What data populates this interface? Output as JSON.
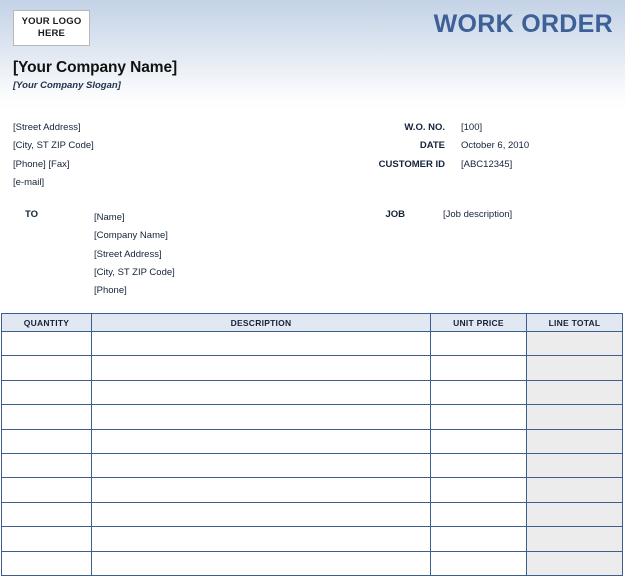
{
  "header": {
    "logo_placeholder_line1": "YOUR LOGO",
    "logo_placeholder_line2": "HERE",
    "document_title": "WORK ORDER",
    "title_color": "#3c6097",
    "company_name": "[Your Company Name]",
    "company_slogan": "[Your Company Slogan]"
  },
  "sender_address": {
    "lines": [
      "[Street Address]",
      "[City, ST  ZIP Code]",
      "[Phone] [Fax]",
      "[e-mail]"
    ]
  },
  "meta": {
    "rows": [
      {
        "label": "W.O. NO.",
        "value": "[100]"
      },
      {
        "label": "DATE",
        "value": "October 6, 2010"
      },
      {
        "label": "CUSTOMER ID",
        "value": "[ABC12345]"
      }
    ]
  },
  "recipient": {
    "label": "TO",
    "lines": [
      "[Name]",
      "[Company Name]",
      "[Street Address]",
      "[City, ST  ZIP Code]",
      "[Phone]"
    ]
  },
  "job": {
    "label": "JOB",
    "value": "[Job description]"
  },
  "line_items_table": {
    "columns": [
      {
        "key": "quantity",
        "label": "QUANTITY"
      },
      {
        "key": "description",
        "label": "DESCRIPTION"
      },
      {
        "key": "unit_price",
        "label": "UNIT PRICE"
      },
      {
        "key": "line_total",
        "label": "LINE TOTAL"
      }
    ],
    "rows": [
      {
        "quantity": "",
        "description": "",
        "unit_price": "",
        "line_total": ""
      },
      {
        "quantity": "",
        "description": "",
        "unit_price": "",
        "line_total": ""
      },
      {
        "quantity": "",
        "description": "",
        "unit_price": "",
        "line_total": ""
      },
      {
        "quantity": "",
        "description": "",
        "unit_price": "",
        "line_total": ""
      },
      {
        "quantity": "",
        "description": "",
        "unit_price": "",
        "line_total": ""
      },
      {
        "quantity": "",
        "description": "",
        "unit_price": "",
        "line_total": ""
      },
      {
        "quantity": "",
        "description": "",
        "unit_price": "",
        "line_total": ""
      },
      {
        "quantity": "",
        "description": "",
        "unit_price": "",
        "line_total": ""
      },
      {
        "quantity": "",
        "description": "",
        "unit_price": "",
        "line_total": ""
      },
      {
        "quantity": "",
        "description": "",
        "unit_price": "",
        "line_total": ""
      }
    ],
    "header_background": "#e2e8f2",
    "border_color": "#3b608f",
    "total_column_background": "#ececec"
  }
}
